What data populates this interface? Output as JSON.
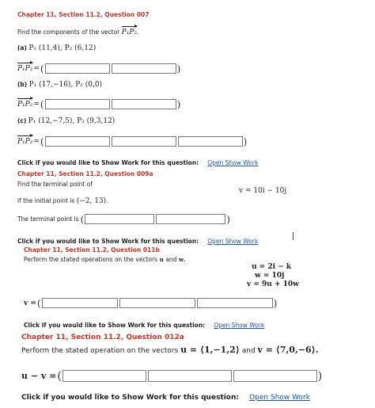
{
  "q007": {
    "header": "Chapter 11, Section 11.2, Question 007",
    "prompt": "Find the components of the vector",
    "vec": "P₁P₂",
    "vec_suffix": ".",
    "parts": [
      {
        "label": "(a)",
        "points": "P₁ (11,4),  P₂ (6,12)"
      },
      {
        "label": "(b)",
        "points": "P₁ (17,−16),  P₂ (0,0)"
      },
      {
        "label": "(c)",
        "points": "P₁ (12,−7,5),  P₂ (9,3,12)"
      }
    ],
    "eq": "=",
    "show_work_label": "Click if you would like to Show Work for this question:",
    "show_work_link": "Open Show Work"
  },
  "q009a": {
    "header": "Chapter 11, Section 11.2, Question 009a",
    "prompt": "Find the terminal point of",
    "vector_eq": "v = 10i − 10j",
    "initial_text": "if the initial point is",
    "initial_point": "(−2, 13).",
    "terminal_label": "The terminal point is",
    "show_work_label": "Click if you would like to Show Work for this question:",
    "show_work_link": "Open Show Work"
  },
  "q011b": {
    "header": "Chapter 11, Section 11.2, Question 011b",
    "prompt_pre": "Perform the stated operations on the vectors",
    "u": "u",
    "and": "and",
    "w": "w",
    "prompt_post": ".",
    "eqs": [
      "u = 2i − k",
      "w = 10j",
      "v = 9u + 10w"
    ],
    "answer_label": "v =",
    "show_work_label": "Click if you would like to Show Work for this question:",
    "show_work_link": "Open Show Work"
  },
  "q012a": {
    "header": "Chapter 11, Section 11.2, Question 012a",
    "prompt_pre": "Perform the stated operation on the vectors",
    "u_def": "u = ⟨1,−1,2⟩",
    "and": "and",
    "v_def": "v = ⟨7,0,−6⟩.",
    "answer_label": "u − v =",
    "show_work_label": "Click if you would like to Show Work for this question:",
    "show_work_link": "Open Show Work"
  },
  "glyphs": {
    "paren_l": "(",
    "paren_r": ")"
  }
}
